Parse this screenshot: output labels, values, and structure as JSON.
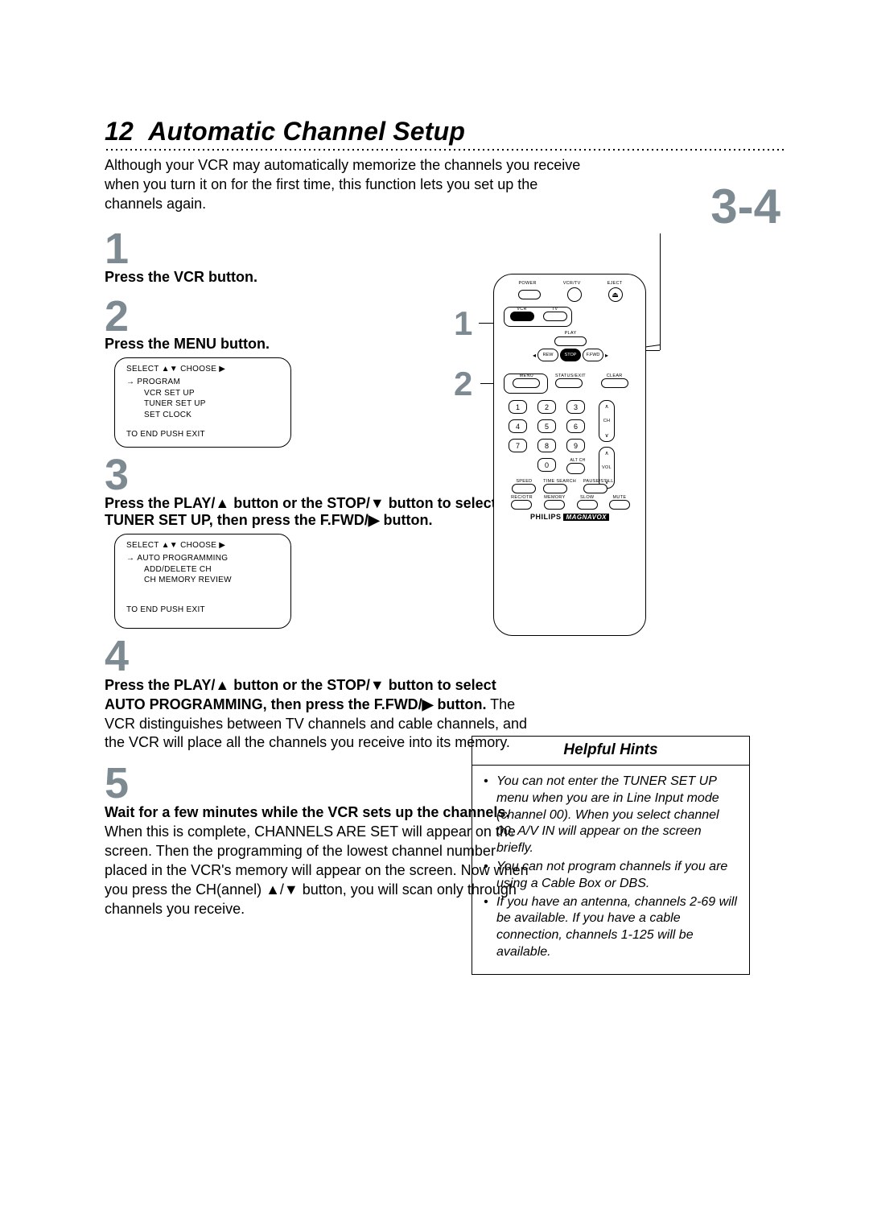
{
  "page_number": "12",
  "title": "Automatic Channel Setup",
  "intro": "Although your VCR may automatically memorize the channels you receive when you turn it on for the first time, this function lets you set up the channels again.",
  "steps": {
    "1": {
      "num": "1",
      "bold": "Press the VCR button."
    },
    "2": {
      "num": "2",
      "bold": "Press the MENU button."
    },
    "3": {
      "num": "3",
      "bold": "Press the PLAY/▲ button or the STOP/▼ button to select TUNER SET UP, then press the F.FWD/▶ button."
    },
    "4": {
      "num": "4",
      "bold": "Press the PLAY/▲ button or the STOP/▼ button to select AUTO PROGRAMMING, then press the F.FWD/▶ button.",
      "body": " The VCR distinguishes between TV channels and cable channels, and the VCR will place all the channels you receive into its memory."
    },
    "5": {
      "num": "5",
      "bold": "Wait for a few minutes while the VCR sets up the channels.",
      "body": " When this is complete, CHANNELS ARE SET will appear on the screen. Then the programming of the lowest channel number placed in the VCR's memory will appear on the screen. Now when you press the CH(annel) ▲/▼ button, you will scan only through channels you receive."
    }
  },
  "osd1": {
    "header": "SELECT ▲▼ CHOOSE ▶",
    "items": [
      "PROGRAM",
      "VCR SET UP",
      "TUNER SET UP",
      "SET CLOCK"
    ],
    "footer": "TO END PUSH EXIT"
  },
  "osd2": {
    "header": "SELECT ▲▼ CHOOSE ▶",
    "items": [
      "AUTO PROGRAMMING",
      "ADD/DELETE CH",
      "CH MEMORY REVIEW"
    ],
    "footer": "TO END PUSH EXIT"
  },
  "side": {
    "big": "3-4",
    "one": "1",
    "two": "2"
  },
  "remote": {
    "row1": [
      "POWER",
      "VCR/TV",
      "EJECT"
    ],
    "row2": [
      "VCR",
      "TV"
    ],
    "play": "PLAY",
    "rew": "REW",
    "ffwd": "F.FWD",
    "stop": "STOP",
    "row3": [
      "MENU",
      "STATUS/EXIT",
      "CLEAR"
    ],
    "nums": [
      "1",
      "2",
      "3",
      "4",
      "5",
      "6",
      "7",
      "8",
      "9",
      "0"
    ],
    "altch": "ALT CH",
    "ch": "CH",
    "vol": "VOL",
    "row4": [
      "SPEED",
      "TIME SEARCH",
      "PAUSE/STILL"
    ],
    "row5": [
      "REC/OTR",
      "MEMORY",
      "SLOW",
      "MUTE"
    ],
    "brand1": "PHILIPS",
    "brand2": "MAGNAVOX"
  },
  "hints": {
    "heading": "Helpful Hints",
    "items": [
      "You can not enter the TUNER SET UP menu when you are in Line Input mode (channel 00). When you select channel 00, A/V IN will appear on the screen briefly.",
      "You can not program channels if you are using a Cable Box or DBS.",
      "If you have an antenna, channels 2-69 will be available. If you have a cable connection, channels 1-125 will be available."
    ]
  }
}
